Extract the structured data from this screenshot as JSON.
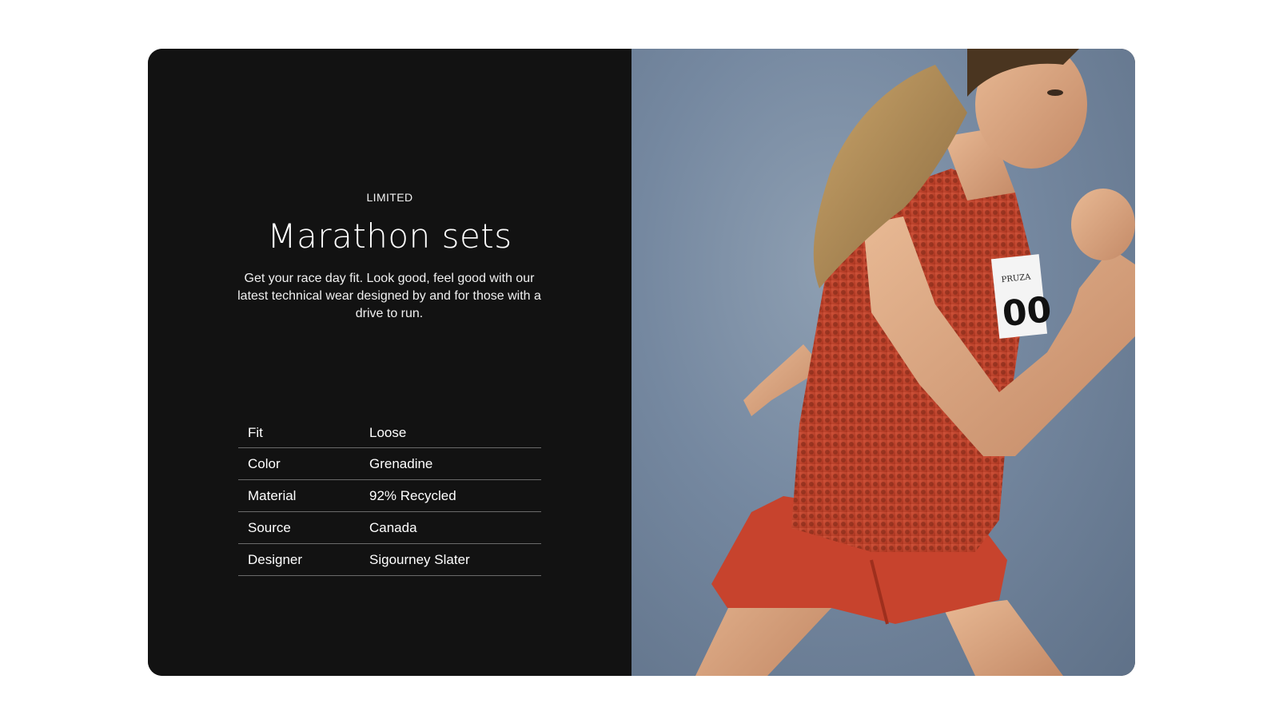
{
  "feature": {
    "eyebrow": "LIMITED",
    "title": "Marathon sets",
    "description": "Get your race day fit. Look good, feel good with our latest technical wear designed by and for those with a drive to run."
  },
  "specs": [
    {
      "label": "Fit",
      "value": "Loose"
    },
    {
      "label": "Color",
      "value": "Grenadine"
    },
    {
      "label": "Material",
      "value": "92% Recycled"
    },
    {
      "label": "Source",
      "value": "Canada"
    },
    {
      "label": "Designer",
      "value": "Sigourney Slater"
    }
  ],
  "photo": {
    "bib_text": "PRUZA",
    "bib_number": "00"
  },
  "colors": {
    "panel_bg": "#121212",
    "accent_grenadine": "#c8432b",
    "photo_bg": "#7588a0"
  }
}
